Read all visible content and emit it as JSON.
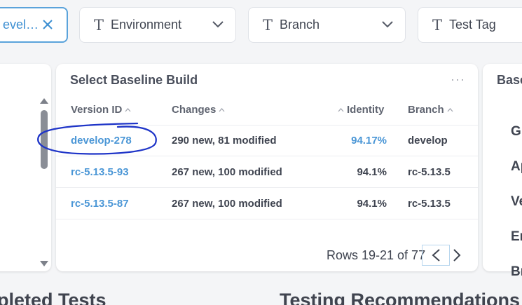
{
  "filters": [
    {
      "label": "evel…",
      "active": true
    },
    {
      "label": "Environment",
      "active": false
    },
    {
      "label": "Branch",
      "active": false
    },
    {
      "label": "Test Tag",
      "active": false
    }
  ],
  "baseline": {
    "title": "Select Baseline Build",
    "more_icon": "···",
    "columns": {
      "version": "Version ID",
      "changes": "Changes",
      "identity": "Identity",
      "branch": "Branch"
    },
    "rows": [
      {
        "version": "develop-278",
        "changes": "290 new, 81 modified",
        "identity": "94.17%",
        "branch": "develop",
        "identity_highlight": true
      },
      {
        "version": "rc-5.13.5-93",
        "changes": "267 new, 100 modified",
        "identity": "94.1%",
        "branch": "rc-5.13.5",
        "identity_highlight": false
      },
      {
        "version": "rc-5.13.5-87",
        "changes": "267 new, 100 modified",
        "identity": "94.1%",
        "branch": "rc-5.13.5",
        "identity_highlight": false
      }
    ],
    "pagination": "Rows 19-21 of 77"
  },
  "right_panel": {
    "title": "Base",
    "items": [
      "Gr",
      "Ap",
      "Ve",
      "En",
      "Br"
    ]
  },
  "sections": {
    "left": "pleted Tests",
    "right": "Testing Recommendations"
  },
  "colors": {
    "accent": "#4a96d6",
    "annotation": "#1f35c8"
  }
}
